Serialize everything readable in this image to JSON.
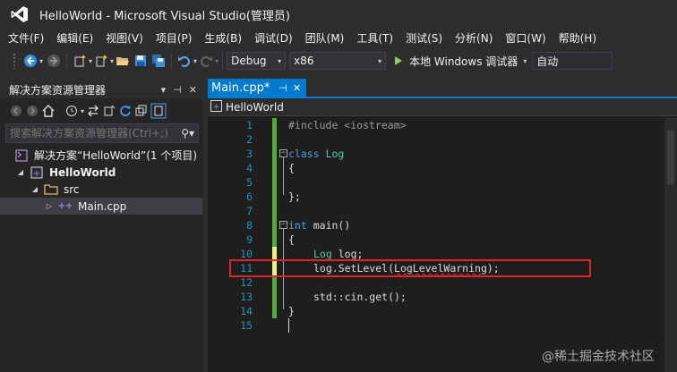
{
  "window": {
    "title": "HelloWorld - Microsoft Visual Studio(管理员)"
  },
  "menu": [
    "文件(F)",
    "编辑(E)",
    "视图(V)",
    "项目(P)",
    "生成(B)",
    "调试(D)",
    "团队(M)",
    "工具(T)",
    "测试(S)",
    "分析(N)",
    "窗口(W)",
    "帮助(H)"
  ],
  "toolbar": {
    "configuration": "Debug",
    "platform": "x86",
    "run_label": "本地 Windows 调试器",
    "auto_label": "自动"
  },
  "solution_explorer": {
    "title": "解决方案资源管理器",
    "search_placeholder": "搜索解决方案资源管理器(Ctrl+;)",
    "solution_label": "解决方案“HelloWorld”(1 个项目)",
    "project_label": "HelloWorld",
    "folder_label": "src",
    "file_label": "Main.cpp"
  },
  "editor": {
    "tab_label": "Main.cpp*",
    "nav_label": "HelloWorld",
    "line_numbers": [
      "1",
      "2",
      "3",
      "4",
      "5",
      "6",
      "7",
      "8",
      "9",
      "10",
      "11",
      "12",
      "13",
      "14",
      "15"
    ],
    "code": {
      "l1": "#include <iostream>",
      "l3_kw": "class",
      "l3_name": "Log",
      "l4": "{",
      "l6": "};",
      "l8_kw": "int",
      "l8_rest": "main()",
      "l9": "{",
      "l10_type": "Log",
      "l10_rest": "log;",
      "l11_obj": "log.SetLevel(",
      "l11_arg": "LogLevelWarning",
      "l11_end": ");",
      "l13": "std::cin.get();",
      "l14": "}"
    }
  },
  "watermark": "@稀土掘金技术社区",
  "colors": {
    "accent": "#007acc",
    "background": "#2d2d30",
    "editor_bg": "#1e1e1e",
    "highlight_box": "#e0252b",
    "change_saved": "#57a64a",
    "change_unsaved": "#efef91"
  }
}
